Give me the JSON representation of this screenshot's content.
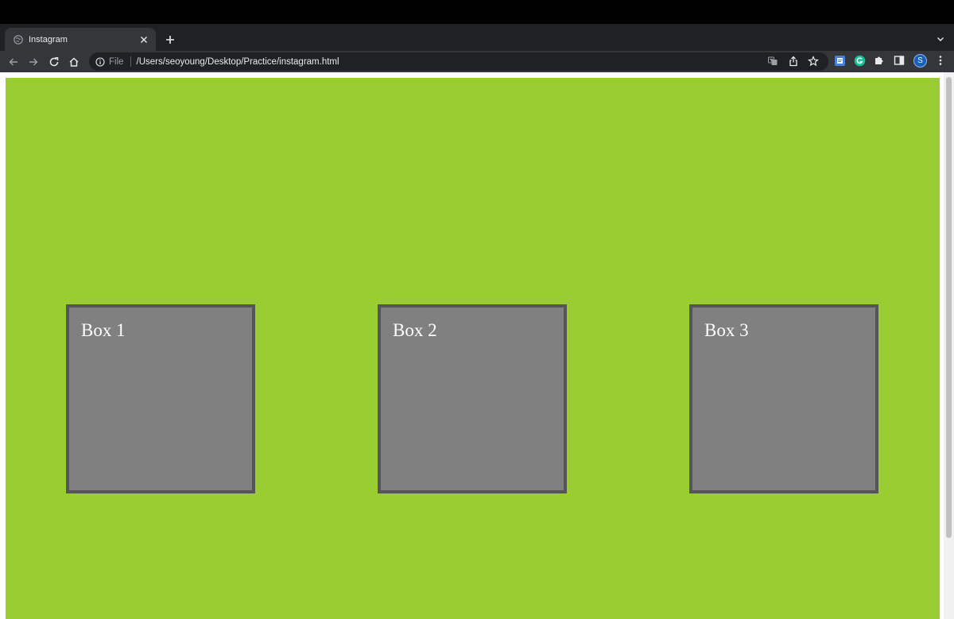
{
  "tab": {
    "title": "Instagram"
  },
  "omnibox": {
    "scheme_label": "File",
    "url": "/Users/seoyoung/Desktop/Practice/instagram.html"
  },
  "profile": {
    "initial": "S"
  },
  "page": {
    "background_color": "#9acd32",
    "boxes": [
      {
        "label": "Box 1"
      },
      {
        "label": "Box 2"
      },
      {
        "label": "Box 3"
      }
    ]
  },
  "icons": {
    "favicon": "globe-icon",
    "tab_close": "close-icon",
    "new_tab": "plus-icon",
    "tab_search": "chevron-down-icon",
    "back": "arrow-left-icon",
    "forward": "arrow-right-icon",
    "reload": "reload-icon",
    "home": "home-icon",
    "translate": "translate-icon",
    "share": "share-icon",
    "bookmark": "star-icon",
    "extension_docs": "docs-extension-icon",
    "extension_grammarly": "grammarly-icon",
    "extensions": "puzzle-icon",
    "side_panel": "side-panel-icon",
    "menu": "kebab-menu-icon"
  }
}
